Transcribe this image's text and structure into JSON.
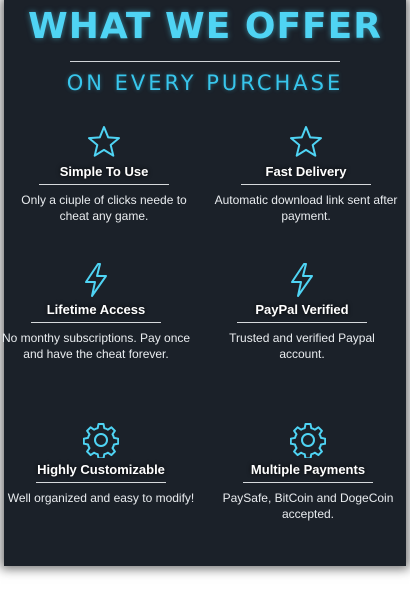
{
  "header": {
    "title": "WHAT WE OFFER",
    "subtitle": "ON EVERY PURCHASE"
  },
  "colors": {
    "accent": "#4fd4f4",
    "background": "#1b2129"
  },
  "features": [
    {
      "icon": "star-icon",
      "title": "Simple To Use",
      "description": "Only a ciuple of clicks neede to cheat any game."
    },
    {
      "icon": "star-icon",
      "title": "Fast Delivery",
      "description": "Automatic download link sent after payment."
    },
    {
      "icon": "lightning-icon",
      "title": "Lifetime Access",
      "description": "No monthy subscriptions. Pay once and have the cheat forever."
    },
    {
      "icon": "lightning-icon",
      "title": "PayPal Verified",
      "description": "Trusted and verified Paypal account."
    },
    {
      "icon": "gear-icon",
      "title": "Highly Customizable",
      "description": "Well organized and easy to modify!"
    },
    {
      "icon": "gear-icon",
      "title": "Multiple Payments",
      "description": "PaySafe, BitCoin and DogeCoin accepted."
    }
  ]
}
